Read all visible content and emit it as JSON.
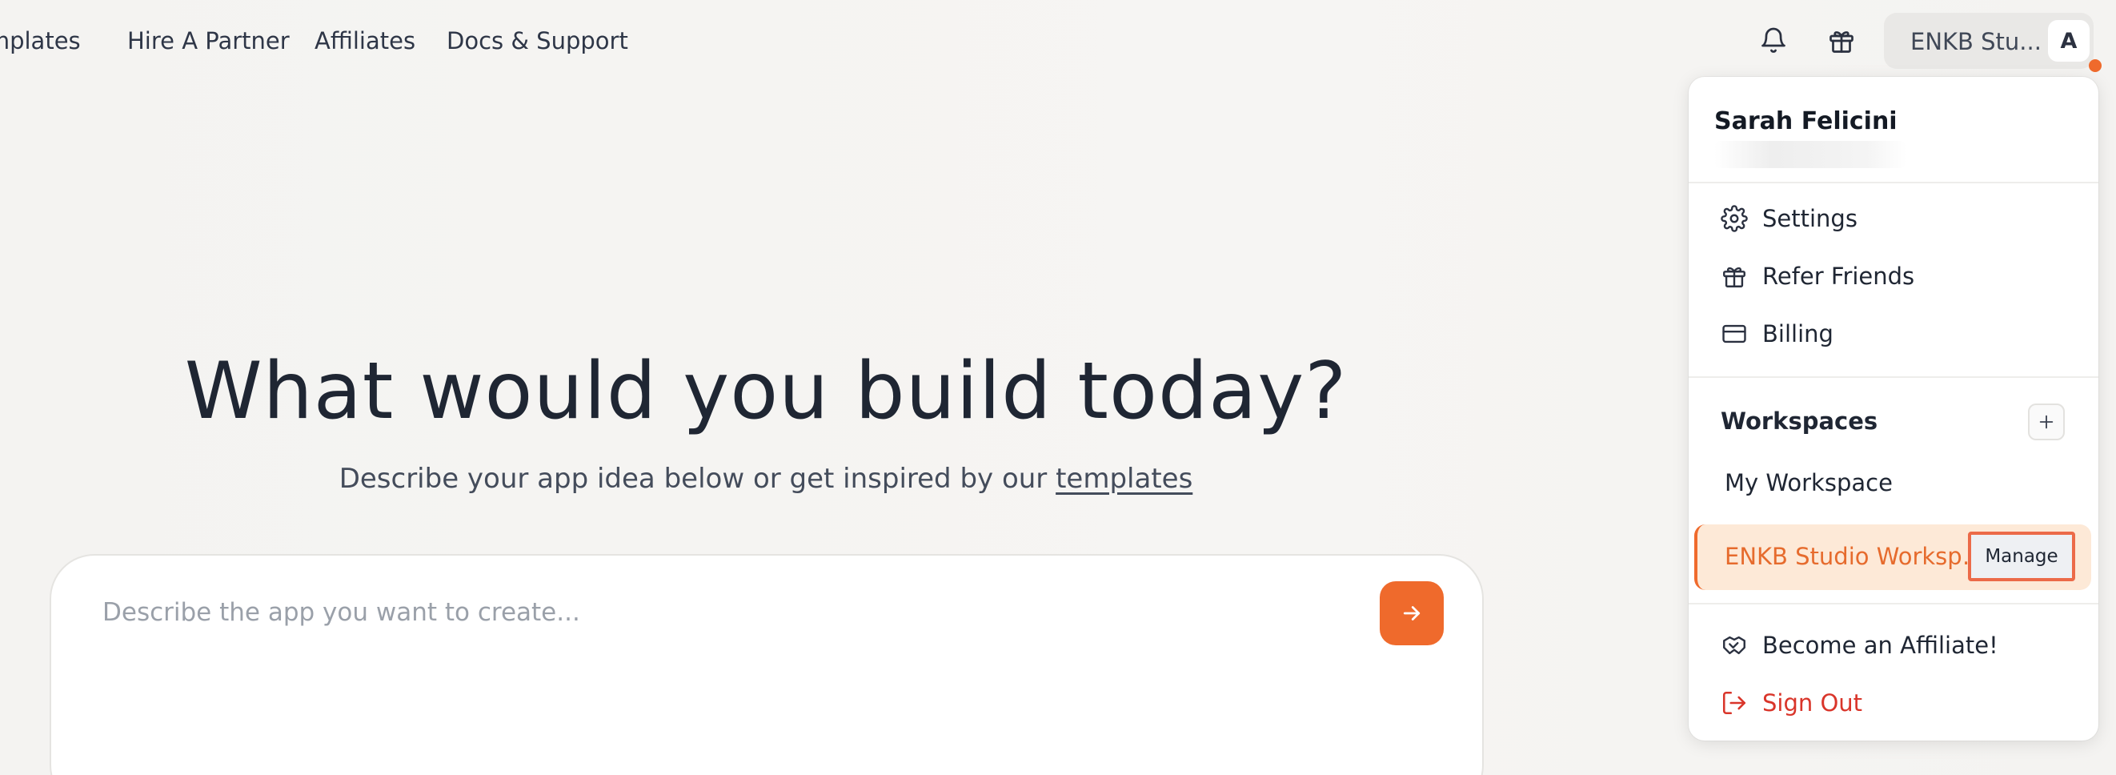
{
  "nav": {
    "templates": "emplates",
    "hire": "Hire A Partner",
    "affiliates": "Affiliates",
    "docs": "Docs & Support"
  },
  "header": {
    "notification_icon": "bell-icon",
    "gift_icon": "gift-icon",
    "workspace_label": "ENKB Stu...",
    "avatar_letter": "A"
  },
  "hero": {
    "title": "What would you build today?",
    "subtitle_prefix": "Describe your app idea below or get inspired by our ",
    "subtitle_link": "templates",
    "prompt_placeholder": "Describe the app you want to create...",
    "prompt_value": ""
  },
  "dropdown": {
    "user_name": "Sarah Felicini",
    "menu": [
      {
        "label": "Settings",
        "icon": "gear-icon"
      },
      {
        "label": "Refer Friends",
        "icon": "gift-icon"
      },
      {
        "label": "Billing",
        "icon": "credit-card-icon"
      }
    ],
    "workspaces_heading": "Workspaces",
    "workspaces": [
      {
        "label": "My Workspace"
      },
      {
        "label": "ENKB Studio Workspace",
        "active": true
      }
    ],
    "manage_label": "Manage",
    "affiliate_label": "Become an Affiliate!",
    "signout_label": "Sign Out"
  },
  "colors": {
    "accent": "#ef6a2c",
    "active_bg": "#fde9d7",
    "danger": "#d9352a",
    "highlight_border": "#ec6a48"
  }
}
